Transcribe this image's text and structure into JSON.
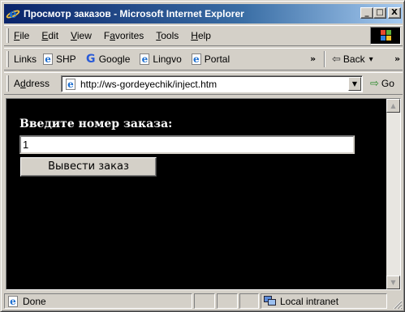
{
  "window": {
    "title": "Просмотр заказов - Microsoft Internet Explorer",
    "controls": {
      "minimize": "_",
      "maximize": "□",
      "close": "X"
    }
  },
  "menubar": {
    "items": [
      {
        "label": "File",
        "accel": "F"
      },
      {
        "label": "Edit",
        "accel": "E"
      },
      {
        "label": "View",
        "accel": "V"
      },
      {
        "label": "Favorites",
        "accel": "a"
      },
      {
        "label": "Tools",
        "accel": "T"
      },
      {
        "label": "Help",
        "accel": "H"
      }
    ]
  },
  "links_bar": {
    "label": "Links",
    "items": [
      {
        "label": "SHP",
        "icon": "ie-page-icon"
      },
      {
        "label": "Google",
        "icon": "google-icon"
      },
      {
        "label": "Lingvo",
        "icon": "ie-page-icon"
      },
      {
        "label": "Portal",
        "icon": "ie-page-icon"
      }
    ],
    "overflow_chevron": "»",
    "back_label": "Back",
    "back_dropdown": "▾",
    "overflow_chevron_right": "»"
  },
  "address_bar": {
    "label": "Address",
    "accel": "d",
    "url": "http://ws-gordeyechik/inject.htm",
    "go_label": "Go"
  },
  "page": {
    "prompt_label": "Введите номер заказа:",
    "order_input_value": "1",
    "submit_label": "Вывести заказ"
  },
  "status_bar": {
    "status_text": "Done",
    "zone_text": "Local intranet"
  }
}
